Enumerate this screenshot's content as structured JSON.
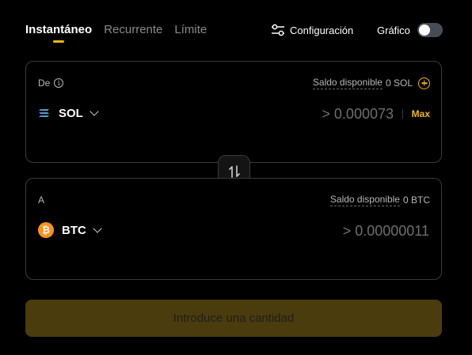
{
  "tabs": [
    {
      "label": "Instantáneo",
      "active": true
    },
    {
      "label": "Recurrente",
      "active": false
    },
    {
      "label": "Límite",
      "active": false
    }
  ],
  "toolbar": {
    "config_label": "Configuración",
    "config_icon": "sliders-icon",
    "chart_label": "Gráfico",
    "chart_toggle_on": false
  },
  "from": {
    "label": "De",
    "balance_label": "Saldo disponible",
    "balance_value": "0 SOL",
    "asset": "SOL",
    "asset_icon": "solana-icon",
    "amount_placeholder": "> 0.000073",
    "max_label": "Max"
  },
  "to": {
    "label": "A",
    "balance_label": "Saldo disponible",
    "balance_value": "0 BTC",
    "asset": "BTC",
    "asset_icon": "bitcoin-icon",
    "amount_placeholder": "> 0.00000011"
  },
  "submit": {
    "label": "Introduce una cantidad"
  },
  "colors": {
    "accent": "#f0b90b",
    "background": "#000000",
    "border": "#3a3a3a",
    "button_disabled": "#4a3c0c"
  }
}
